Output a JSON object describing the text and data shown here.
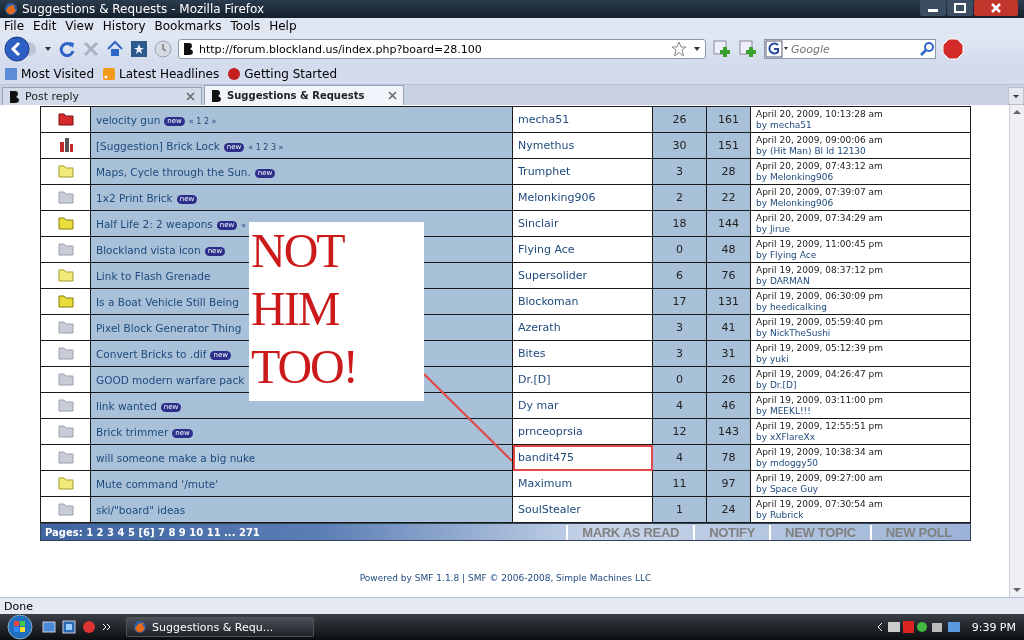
{
  "window": {
    "title": "Suggestions & Requests - Mozilla Firefox"
  },
  "menu": [
    "File",
    "Edit",
    "View",
    "History",
    "Bookmarks",
    "Tools",
    "Help"
  ],
  "address_bar": {
    "value": "http://forum.blockland.us/index.php?board=28.100"
  },
  "search": {
    "placeholder": "Google"
  },
  "bookmarks": [
    "Most Visited",
    "Latest Headlines",
    "Getting Started"
  ],
  "tabs": [
    {
      "label": "Post reply",
      "selected": false
    },
    {
      "label": "Suggestions & Requests",
      "selected": true
    }
  ],
  "topics": [
    {
      "kind": "veryhot",
      "subject": "velocity gun",
      "badge": "new",
      "pages": "« 1 2 »",
      "starter": "mecha51",
      "replies": "26",
      "views": "161",
      "last_post": "April 20, 2009, 10:13:28 am",
      "last_by": "by mecha51",
      "circled": false
    },
    {
      "kind": "poll",
      "subject": "[Suggestion] Brick Lock",
      "badge": "new",
      "pages": "« 1 2 3 »",
      "starter": "Nymethus",
      "replies": "30",
      "views": "151",
      "last_post": "April 20, 2009, 09:00:06 am",
      "last_by": "by (Hit Man) Bl Id 12130",
      "circled": false
    },
    {
      "kind": "posted",
      "subject": "Maps, Cycle through the Sun.",
      "badge": "new",
      "starter": "Trumphet",
      "replies": "3",
      "views": "28",
      "last_post": "April 20, 2009, 07:43:12 am",
      "last_by": "by Melonking906",
      "circled": false
    },
    {
      "kind": "normal",
      "subject": "1x2 Print Brick",
      "badge": "new",
      "starter": "Melonking906",
      "replies": "2",
      "views": "22",
      "last_post": "April 20, 2009, 07:39:07 am",
      "last_by": "by Melonking906",
      "circled": false
    },
    {
      "kind": "hot",
      "subject": "Half Life 2: 2 weapons",
      "badge": "new",
      "pages": "«",
      "starter": "Sinclair",
      "replies": "18",
      "views": "144",
      "last_post": "April 20, 2009, 07:34:29 am",
      "last_by": "by Jirue",
      "circled": false
    },
    {
      "kind": "normal",
      "subject": "Blockland vista icon",
      "badge": "new",
      "starter": "Flying Ace",
      "replies": "0",
      "views": "48",
      "last_post": "April 19, 2009, 11:00:45 pm",
      "last_by": "by Flying Ace",
      "circled": false
    },
    {
      "kind": "posted",
      "subject": "Link to Flash Grenade",
      "starter": "Supersolider",
      "replies": "6",
      "views": "76",
      "last_post": "April 19, 2009, 08:37:12 pm",
      "last_by": "by DARMAN",
      "circled": false
    },
    {
      "kind": "hot",
      "subject": "Is a Boat Vehicle Still Being",
      "starter": "Blockoman",
      "replies": "17",
      "views": "131",
      "last_post": "April 19, 2009, 06:30:09 pm",
      "last_by": "by heedicalking",
      "circled": false
    },
    {
      "kind": "normal",
      "subject": "Pixel Block Generator Thing",
      "starter": "Azerath",
      "replies": "3",
      "views": "41",
      "last_post": "April 19, 2009, 05:59:40 pm",
      "last_by": "by NickTheSushi",
      "circled": false
    },
    {
      "kind": "normal",
      "subject": "Convert Bricks to .dif",
      "badge": "new",
      "starter": "Bites",
      "replies": "3",
      "views": "31",
      "last_post": "April 19, 2009, 05:12:39 pm",
      "last_by": "by yuki",
      "circled": false
    },
    {
      "kind": "normal",
      "subject": "GOOD modern warfare pack",
      "starter": "Dr.[D]",
      "replies": "0",
      "views": "26",
      "last_post": "April 19, 2009, 04:26:47 pm",
      "last_by": "by Dr.[D]",
      "circled": false
    },
    {
      "kind": "normal",
      "subject": "link wanted",
      "badge": "new",
      "starter": "Dy mar",
      "replies": "4",
      "views": "46",
      "last_post": "April 19, 2009, 03:11:00 pm",
      "last_by": "by MEEKL!!!",
      "circled": false
    },
    {
      "kind": "normal",
      "subject": "Brick trimmer",
      "badge": "new",
      "starter": "prnceoprsia",
      "replies": "12",
      "views": "143",
      "last_post": "April 19, 2009, 12:55:51 pm",
      "last_by": "by xXFlareXx",
      "circled": false
    },
    {
      "kind": "normal",
      "subject": "will someone make a big nuke",
      "starter": "bandit475",
      "replies": "4",
      "views": "78",
      "last_post": "April 19, 2009, 10:38:34 am",
      "last_by": "by mdoggy50",
      "circled": true
    },
    {
      "kind": "posted",
      "subject": "Mute command '/mute'",
      "starter": "Maximum",
      "replies": "11",
      "views": "97",
      "last_post": "April 19, 2009, 09:27:00 am",
      "last_by": "by Space Guy",
      "circled": false
    },
    {
      "kind": "normal",
      "subject": "ski/\"board\" ideas",
      "starter": "SoulStealer",
      "replies": "1",
      "views": "24",
      "last_post": "April 19, 2009, 07:30:54 am",
      "last_by": "by Rubrick",
      "circled": false
    }
  ],
  "pages": "Pages: 1 2 3 4 5 [6] 7 8 9 10 11 ... 271",
  "actions": [
    "MARK AS READ",
    "NOTIFY",
    "NEW TOPIC",
    "NEW POLL"
  ],
  "overlay": {
    "lines": [
      "NOT",
      "HIM",
      "TOO!"
    ]
  },
  "footer": "Powered by SMF 1.1.8 | SMF © 2006-2008, Simple Machines LLC",
  "status_bar": "Done",
  "taskbar": {
    "task": "Suggestions & Requ...",
    "clock": "9:39 PM"
  }
}
